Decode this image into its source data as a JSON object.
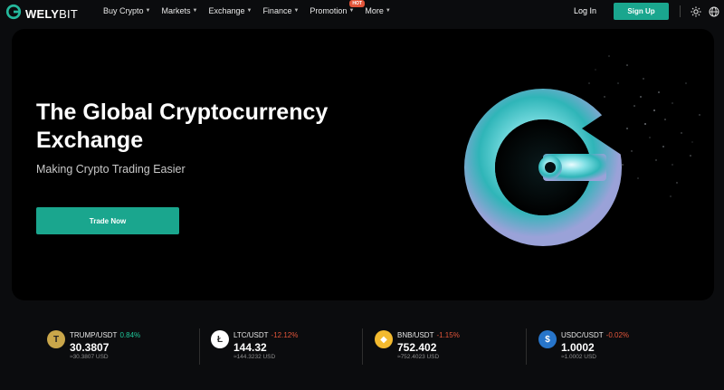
{
  "brand": {
    "name_bold": "WELY",
    "name_light": "BIT",
    "logo_icon": "welybit-logo-icon"
  },
  "nav": {
    "items": [
      {
        "label": "Buy Crypto"
      },
      {
        "label": "Markets"
      },
      {
        "label": "Exchange"
      },
      {
        "label": "Finance"
      },
      {
        "label": "Promotion",
        "badge": "HOT"
      },
      {
        "label": "More"
      }
    ],
    "login_label": "Log In",
    "signup_label": "Sign Up",
    "icons": [
      "sun-icon",
      "globe-icon"
    ]
  },
  "hero": {
    "title": " The Global Cryptocurrency\nExchange",
    "subtitle": "Making Crypto Trading Easier",
    "cta_label": "Trade Now"
  },
  "tickers": [
    {
      "pair": "TRUMP/USDT",
      "change": "0.84%",
      "direction": "up",
      "price": "30.3807",
      "usd": "≈30.3807 USD",
      "icon": "trump-coin-icon"
    },
    {
      "pair": "LTC/USDT",
      "change": "-12.12%",
      "direction": "down",
      "price": "144.32",
      "usd": "≈144.3232 USD",
      "icon": "litecoin-icon"
    },
    {
      "pair": "BNB/USDT",
      "change": "-1.15%",
      "direction": "down",
      "price": "752.402",
      "usd": "≈752.4023 USD",
      "icon": "bnb-icon"
    },
    {
      "pair": "USDC/USDT",
      "change": "-0.02%",
      "direction": "down",
      "price": "1.0002",
      "usd": "≈1.0002 USD",
      "icon": "usdc-icon"
    }
  ],
  "colors": {
    "accent": "#1aa68e",
    "up": "#1fc79a",
    "down": "#e2553a",
    "background": "#0b0c0e"
  }
}
